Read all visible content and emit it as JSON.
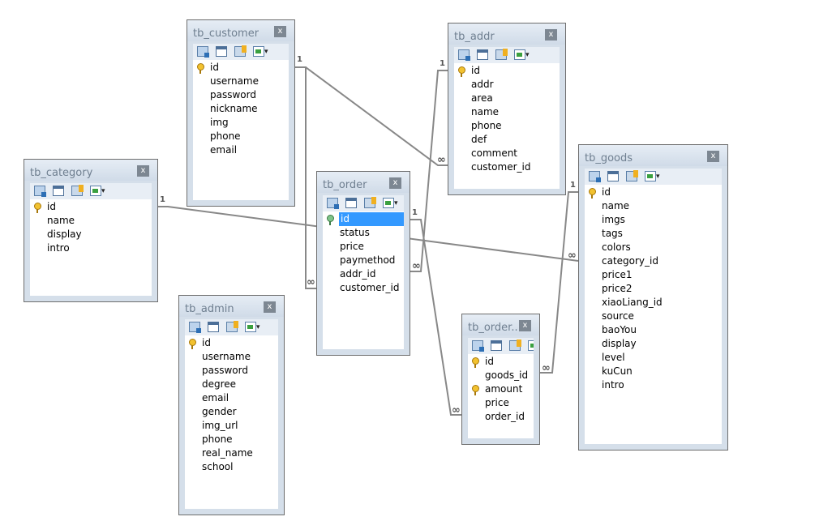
{
  "tables": [
    {
      "id": "customer",
      "title": "tb_customer",
      "close": "x",
      "dropdown": "▾",
      "fields": [
        {
          "name": "id",
          "key": "pk"
        },
        {
          "name": "username"
        },
        {
          "name": "password"
        },
        {
          "name": "nickname"
        },
        {
          "name": "img"
        },
        {
          "name": "phone"
        },
        {
          "name": "email"
        }
      ]
    },
    {
      "id": "addr",
      "title": "tb_addr",
      "close": "x",
      "dropdown": "▾",
      "fields": [
        {
          "name": "id",
          "key": "pk"
        },
        {
          "name": "addr"
        },
        {
          "name": "area"
        },
        {
          "name": "name"
        },
        {
          "name": "phone"
        },
        {
          "name": "def"
        },
        {
          "name": "comment"
        },
        {
          "name": "customer_id"
        }
      ]
    },
    {
      "id": "category",
      "title": "tb_category",
      "close": "x",
      "dropdown": "▾",
      "fields": [
        {
          "name": "id",
          "key": "pk"
        },
        {
          "name": "name"
        },
        {
          "name": "display"
        },
        {
          "name": "intro"
        }
      ]
    },
    {
      "id": "order",
      "title": "tb_order",
      "close": "x",
      "dropdown": "▾",
      "fields": [
        {
          "name": "id",
          "key": "pk-green",
          "selected": true
        },
        {
          "name": "status"
        },
        {
          "name": "price"
        },
        {
          "name": "paymethod"
        },
        {
          "name": "addr_id"
        },
        {
          "name": "customer_id"
        }
      ]
    },
    {
      "id": "goods",
      "title": "tb_goods",
      "close": "x",
      "dropdown": "▾",
      "fields": [
        {
          "name": "id",
          "key": "pk"
        },
        {
          "name": "name"
        },
        {
          "name": "imgs"
        },
        {
          "name": "tags"
        },
        {
          "name": "colors"
        },
        {
          "name": "category_id"
        },
        {
          "name": "price1"
        },
        {
          "name": "price2"
        },
        {
          "name": "xiaoLiang_id"
        },
        {
          "name": "source"
        },
        {
          "name": "baoYou"
        },
        {
          "name": "display"
        },
        {
          "name": "level"
        },
        {
          "name": "kuCun"
        },
        {
          "name": "intro"
        }
      ]
    },
    {
      "id": "admin",
      "title": "tb_admin",
      "close": "x",
      "dropdown": "▾",
      "fields": [
        {
          "name": "id",
          "key": "pk"
        },
        {
          "name": "username"
        },
        {
          "name": "password"
        },
        {
          "name": "degree"
        },
        {
          "name": "email"
        },
        {
          "name": "gender"
        },
        {
          "name": "img_url"
        },
        {
          "name": "phone"
        },
        {
          "name": "real_name"
        },
        {
          "name": "school"
        }
      ]
    },
    {
      "id": "orderitem",
      "title": "tb_order...",
      "close": "x",
      "dropdown": "",
      "fields": [
        {
          "name": "id",
          "key": "pk"
        },
        {
          "name": "goods_id"
        },
        {
          "name": "amount",
          "key": "pk"
        },
        {
          "name": "price"
        },
        {
          "name": "order_id"
        }
      ]
    }
  ],
  "cardinality": {
    "one": "1",
    "many": "∞"
  },
  "colors": {
    "line": "#888888",
    "selection": "#3399ff",
    "frame": "#d5dfea"
  }
}
